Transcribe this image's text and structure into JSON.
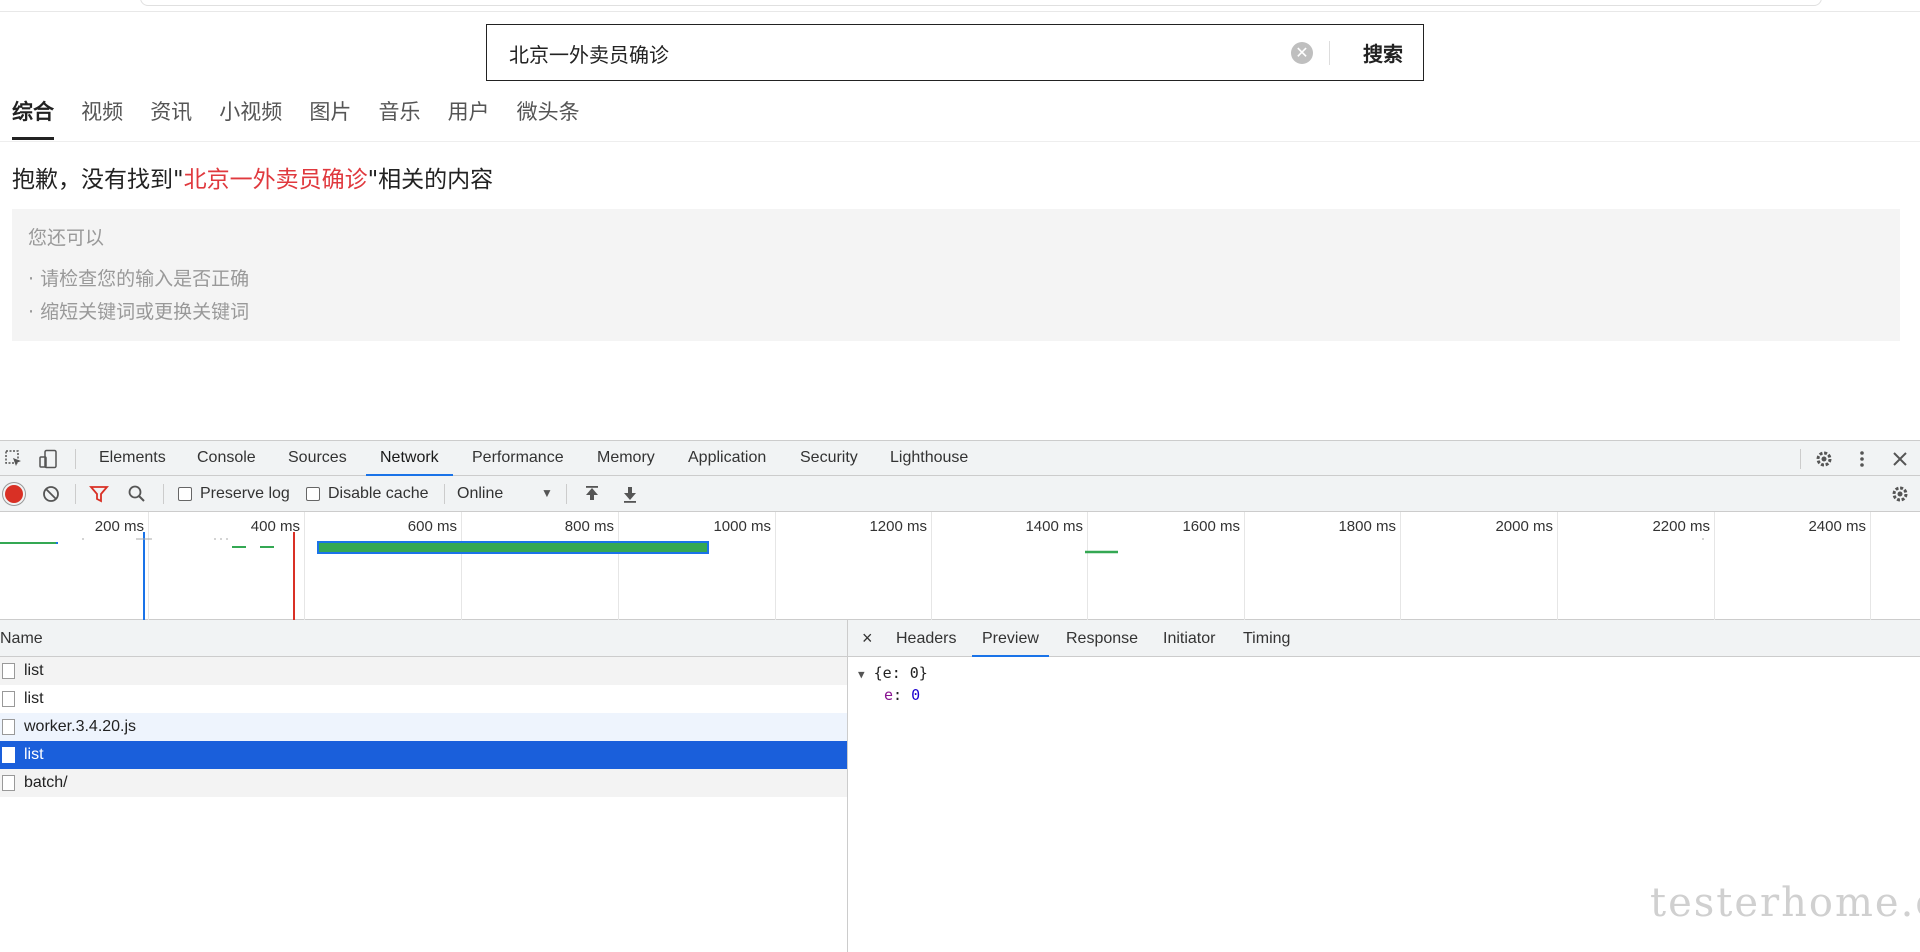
{
  "search": {
    "query": "北京一外卖员确诊",
    "clear_glyph": "✕",
    "button_label": "搜索"
  },
  "category_tabs": [
    {
      "label": "综合",
      "active": true
    },
    {
      "label": "视频"
    },
    {
      "label": "资讯"
    },
    {
      "label": "小视频"
    },
    {
      "label": "图片"
    },
    {
      "label": "音乐"
    },
    {
      "label": "用户"
    },
    {
      "label": "微头条"
    }
  ],
  "result": {
    "prefix": "抱歉，没有找到\"",
    "keyword": "北京一外卖员确诊",
    "suffix": "\"相关的内容"
  },
  "tips": {
    "title": "您还可以",
    "items": [
      "· 请检查您的输入是否正确",
      "· 缩短关键词或更换关键词"
    ]
  },
  "devtools": {
    "tabs": [
      "Elements",
      "Console",
      "Sources",
      "Network",
      "Performance",
      "Memory",
      "Application",
      "Security",
      "Lighthouse"
    ],
    "active_tab": "Network",
    "toolbar": {
      "preserve_log": "Preserve log",
      "disable_cache": "Disable cache",
      "throttling": "Online",
      "dropdown_arrow": "▼"
    },
    "timeline_ticks": [
      "200 ms",
      "400 ms",
      "600 ms",
      "800 ms",
      "1000 ms",
      "1200 ms",
      "1400 ms",
      "1600 ms",
      "1800 ms",
      "2000 ms",
      "2200 ms",
      "2400 ms"
    ],
    "requests_header": "Name",
    "requests": [
      "list",
      "list",
      "worker.3.4.20.js",
      "list",
      "batch/"
    ],
    "selected_request": 3,
    "detail_tabs": [
      "Headers",
      "Preview",
      "Response",
      "Initiator",
      "Timing"
    ],
    "active_detail_tab": "Preview",
    "close_glyph": "×",
    "preview": {
      "summary": "{e: 0}",
      "key": "e",
      "value": "0"
    }
  },
  "watermark": "testerhome.com",
  "colors": {
    "keyword_red": "#e0393e",
    "selected_row": "#1a5fdb",
    "accent_blue": "#1a73e8",
    "record_red": "#d93025"
  }
}
